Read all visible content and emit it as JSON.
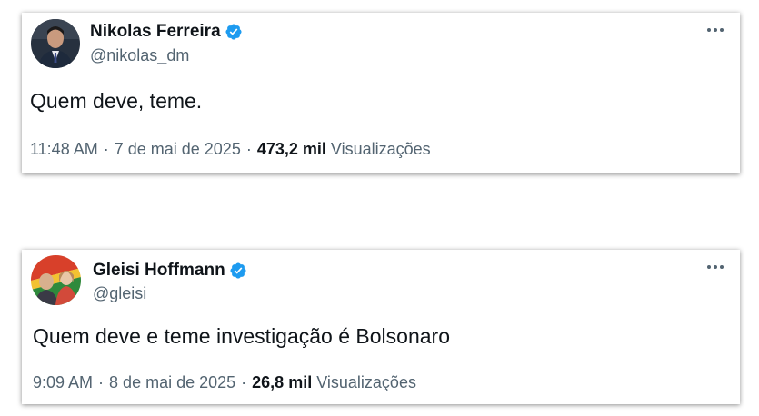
{
  "colors": {
    "text_primary": "#0f1419",
    "text_secondary": "#536471",
    "verified_badge": "#1d9bf0"
  },
  "tweets": [
    {
      "name": "Nikolas Ferreira",
      "handle": "@nikolas_dm",
      "verified": true,
      "text": "Quem deve, teme.",
      "time": "11:48 AM",
      "date": "7 de mai de 2025",
      "views_count": "473,2 mil",
      "views_label": "Visualizações",
      "more_icon": "more-horizontal-icon"
    },
    {
      "name": "Gleisi Hoffmann",
      "handle": "@gleisi",
      "verified": true,
      "text": "Quem deve e teme investigação é Bolsonaro",
      "time": "9:09 AM",
      "date": "8 de mai de 2025",
      "views_count": "26,8 mil",
      "views_label": "Visualizações",
      "more_icon": "more-horizontal-icon"
    }
  ]
}
